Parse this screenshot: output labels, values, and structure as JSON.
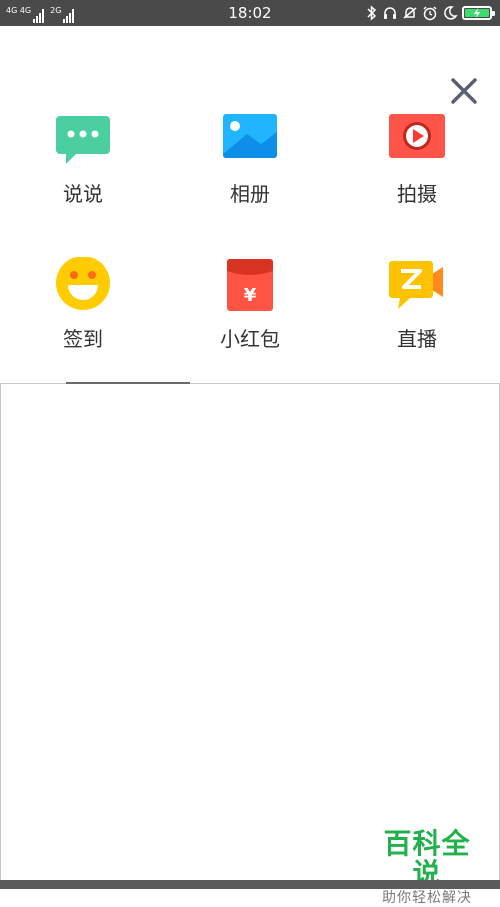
{
  "status_bar": {
    "network_1": "4G 4G",
    "network_2": "2G",
    "time": "18:02"
  },
  "sheet": {
    "items": [
      {
        "label": "说说",
        "icon": "chat-bubble-icon",
        "color": "#4ccfa0"
      },
      {
        "label": "相册",
        "icon": "photo-album-icon",
        "color": "#22b5ff"
      },
      {
        "label": "拍摄",
        "icon": "video-camera-icon",
        "color": "#ff5548"
      },
      {
        "label": "签到",
        "icon": "smiley-face-icon",
        "color": "#ffcc00"
      },
      {
        "label": "小红包",
        "icon": "red-envelope-icon",
        "color": "#ff5343"
      },
      {
        "label": "直播",
        "icon": "live-broadcast-icon",
        "color": "#ffc200"
      }
    ]
  },
  "watermark": {
    "title": "百科全说",
    "subtitle": "助你轻松解决"
  },
  "colors": {
    "status_bar_bg": "#4a4a4a",
    "watermark_green": "#22b14c"
  }
}
